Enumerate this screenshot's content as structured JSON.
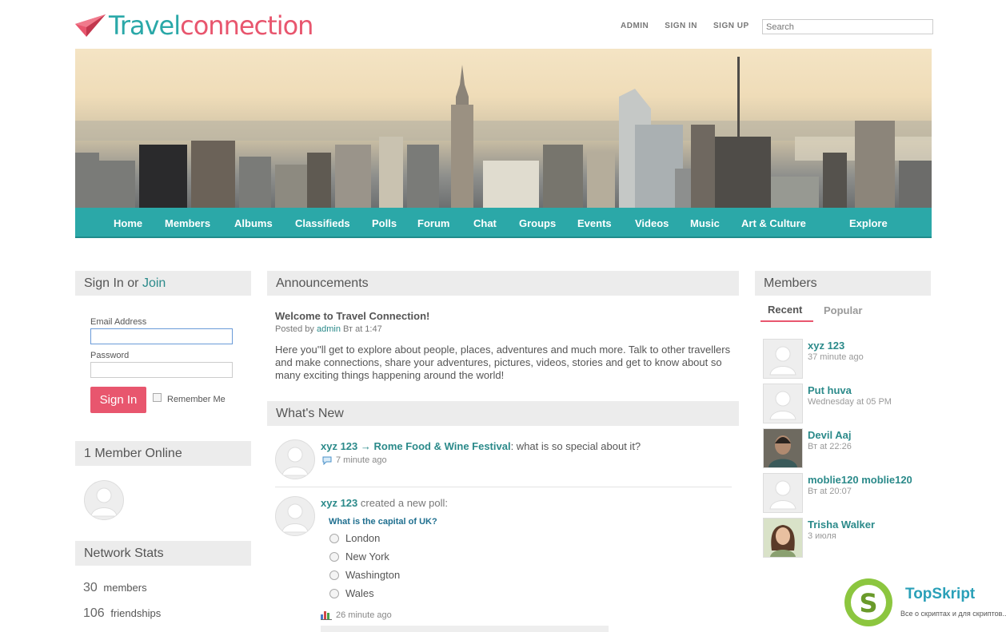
{
  "header": {
    "logo_part1": "Travel",
    "logo_part2": "connection",
    "links": [
      "ADMIN",
      "SIGN IN",
      "SIGN UP"
    ],
    "search_placeholder": "Search"
  },
  "nav": [
    "Home",
    "Members",
    "Albums",
    "Classifieds",
    "Polls",
    "Forum",
    "Chat",
    "Groups",
    "Events",
    "Videos",
    "Music",
    "Art & Culture",
    "Explore"
  ],
  "signin": {
    "title_prefix": "Sign In or ",
    "title_link": "Join",
    "email_label": "Email Address",
    "password_label": "Password",
    "button": "Sign In",
    "remember": "Remember Me"
  },
  "online": {
    "title": "1 Member Online"
  },
  "stats": {
    "title": "Network Stats",
    "items": [
      {
        "count": "30",
        "label": "members"
      },
      {
        "count": "106",
        "label": "friendships"
      }
    ]
  },
  "announcements": {
    "title": "Announcements",
    "post_title": "Welcome to Travel Connection!",
    "posted_by_prefix": "Posted by ",
    "posted_by_user": "admin",
    "posted_time": " Вт at 1:47",
    "body": "Here you''ll get to explore about people, places, adventures and much more. Talk to other travellers and make connections, share your adventures, pictures, videos, stories and get to know about so many exciting things happening around the world!"
  },
  "whats_new": {
    "title": "What's New",
    "item1": {
      "user": "xyz 123",
      "arrow": " → ",
      "target": "Rome Food & Wine Festival",
      "text": ": what is so special about it?",
      "time": "7 minute ago"
    },
    "item2": {
      "user": "xyz 123",
      "text": " created a new poll:",
      "question": "What is the capital of UK?",
      "options": [
        "London",
        "New York",
        "Washington",
        "Wales"
      ],
      "time": "26 minute ago"
    }
  },
  "members": {
    "title": "Members",
    "tabs": [
      "Recent",
      "Popular"
    ],
    "list": [
      {
        "name": "xyz 123",
        "time": "37 minute ago"
      },
      {
        "name": "Put huva",
        "time": "Wednesday at 05 PM"
      },
      {
        "name": "Devil Aaj",
        "time": "Вт at 22:26"
      },
      {
        "name": "moblie120 moblie120",
        "time": "Вт at 20:07"
      },
      {
        "name": "Trisha Walker",
        "time": "3 июля"
      }
    ]
  },
  "watermark": {
    "brand": "TopSkript",
    "tagline": "Все о скриптах и для скриптов..."
  }
}
